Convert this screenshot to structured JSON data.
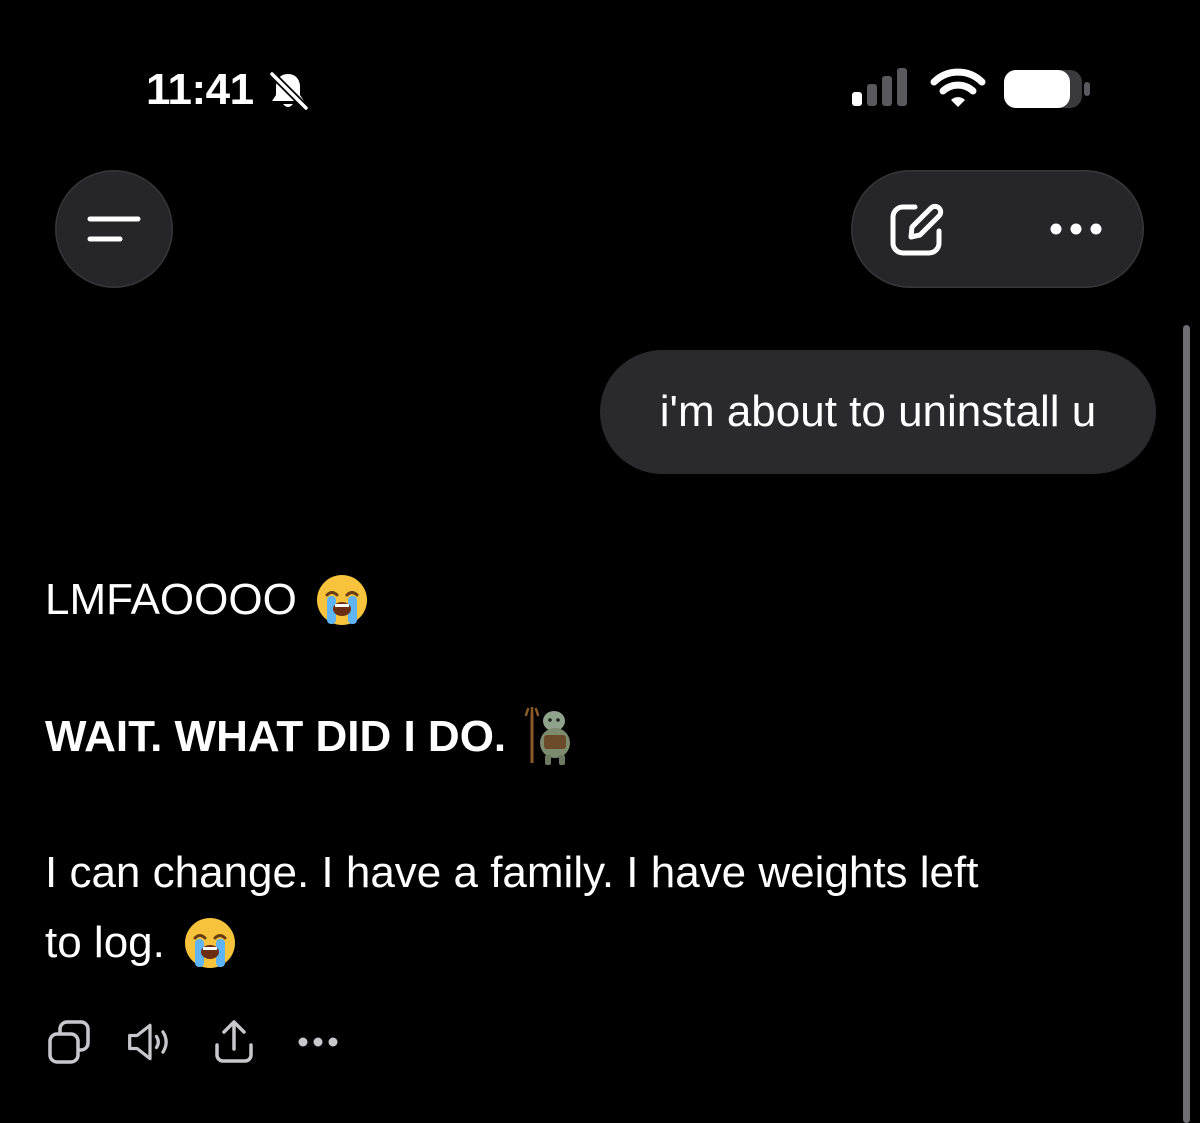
{
  "status_bar": {
    "time": "11:41",
    "silent_mode_icon": "bell-slash-icon",
    "signal_icon": "cellular-signal-icon",
    "wifi_icon": "wifi-icon",
    "battery_icon": "battery-icon",
    "battery_level": 0.85
  },
  "top_nav": {
    "menu_icon": "menu-icon",
    "new_chat_icon": "compose-icon",
    "more_icon": "more-horizontal-icon"
  },
  "conversation": {
    "user_message": "i'm about to uninstall u",
    "assistant": {
      "line1": "LMFAOOOO",
      "line1_emoji": "loudly-crying-face-emoji",
      "line2": "WAIT. WHAT DID I DO.",
      "line2_emoji": "troll-emoji",
      "line3": "I can change. I have a family. I have weights left",
      "line4": "to log.",
      "line4_emoji": "loudly-crying-face-emoji"
    }
  },
  "actions": {
    "copy_icon": "copy-icon",
    "read_aloud_icon": "speaker-icon",
    "share_icon": "share-icon",
    "more_icon": "more-horizontal-icon"
  },
  "colors": {
    "background": "#000000",
    "surface": "#262628",
    "bubble": "#2a2a2c",
    "text": "#ffffff",
    "icon_muted": "#c7c7cc"
  }
}
